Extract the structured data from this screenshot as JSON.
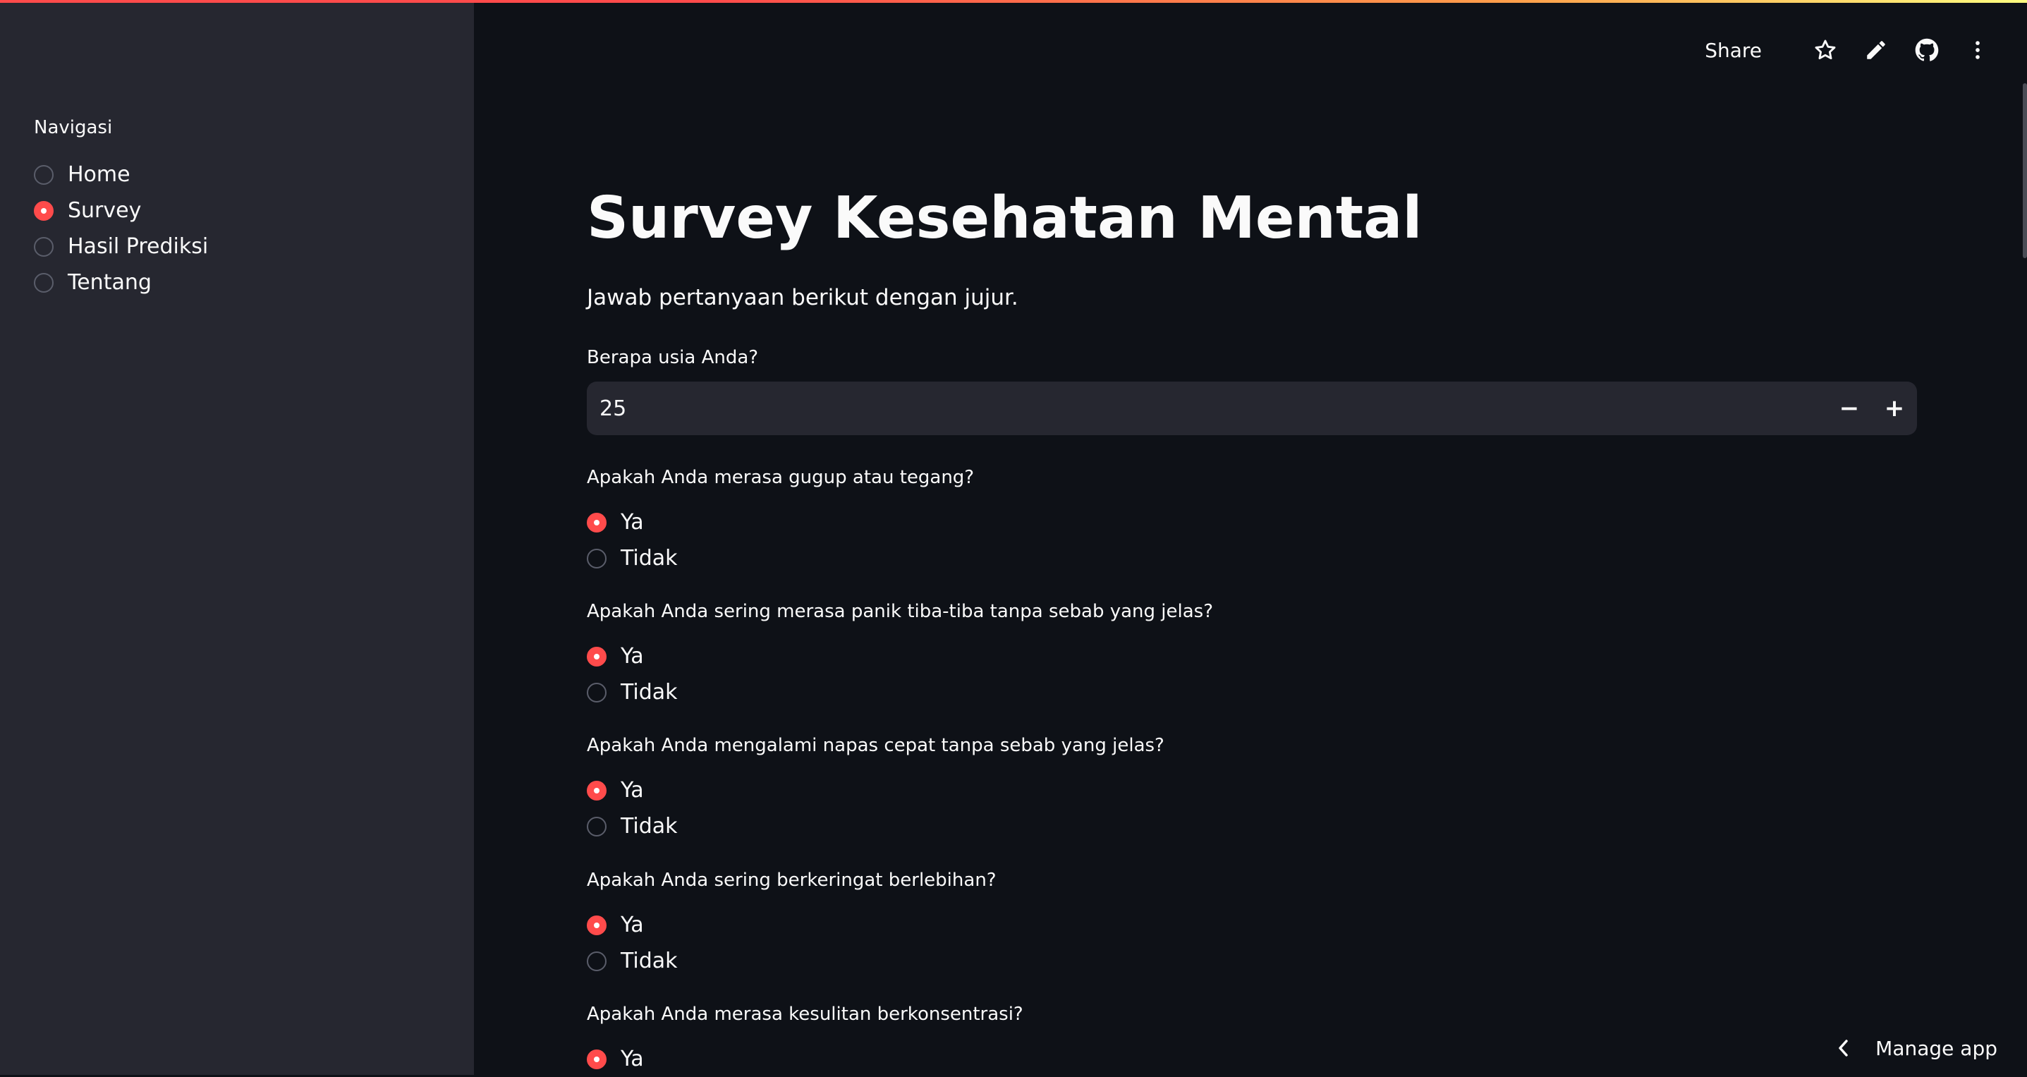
{
  "colors": {
    "accent": "#ff4b4b",
    "background": "#0e1117",
    "sidebar": "#262730",
    "text": "#fafafa"
  },
  "header": {
    "share_label": "Share",
    "icons": [
      "star-icon",
      "pencil-icon",
      "github-icon",
      "kebab-menu-icon"
    ]
  },
  "sidebar": {
    "nav_label": "Navigasi",
    "items": [
      {
        "label": "Home",
        "selected": false
      },
      {
        "label": "Survey",
        "selected": true
      },
      {
        "label": "Hasil Prediksi",
        "selected": false
      },
      {
        "label": "Tentang",
        "selected": false
      }
    ]
  },
  "main": {
    "title": "Survey Kesehatan Mental",
    "subtitle": "Jawab pertanyaan berikut dengan jujur.",
    "age": {
      "label": "Berapa usia Anda?",
      "value": "25",
      "minus": "−",
      "plus": "+"
    },
    "questions": [
      {
        "label": "Apakah Anda merasa gugup atau tegang?",
        "options": [
          "Ya",
          "Tidak"
        ],
        "selected": "Ya"
      },
      {
        "label": "Apakah Anda sering merasa panik tiba-tiba tanpa sebab yang jelas?",
        "options": [
          "Ya",
          "Tidak"
        ],
        "selected": "Ya"
      },
      {
        "label": "Apakah Anda mengalami napas cepat tanpa sebab yang jelas?",
        "options": [
          "Ya",
          "Tidak"
        ],
        "selected": "Ya"
      },
      {
        "label": "Apakah Anda sering berkeringat berlebihan?",
        "options": [
          "Ya",
          "Tidak"
        ],
        "selected": "Ya"
      },
      {
        "label": "Apakah Anda merasa kesulitan berkonsentrasi?",
        "options": [
          "Ya"
        ],
        "selected": "Ya"
      }
    ]
  },
  "footer": {
    "manage_app_label": "Manage app"
  }
}
